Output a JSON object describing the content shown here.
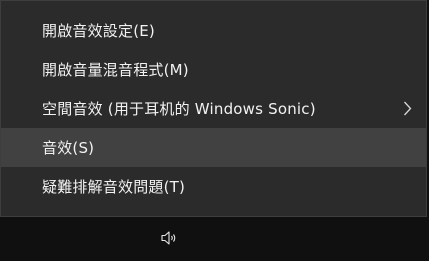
{
  "context_menu": {
    "items": [
      {
        "label": "開啟音效設定(E)",
        "has_submenu": false,
        "highlighted": false
      },
      {
        "label": "開啟音量混音程式(M)",
        "has_submenu": false,
        "highlighted": false
      },
      {
        "label": "空間音效 (用于耳机的 Windows Sonic)",
        "has_submenu": true,
        "highlighted": false
      },
      {
        "label": "音效(S)",
        "has_submenu": false,
        "highlighted": true
      },
      {
        "label": "疑難排解音效問題(T)",
        "has_submenu": false,
        "highlighted": false
      }
    ],
    "submenu_icon": "chevron-right-icon"
  },
  "taskbar": {
    "tray_icon": "speaker-volume-icon"
  },
  "colors": {
    "menu_background": "#2b2b2b",
    "menu_border": "#3e3e3e",
    "highlight": "#414141",
    "text": "#f2f2f2",
    "taskbar": "#101010"
  }
}
